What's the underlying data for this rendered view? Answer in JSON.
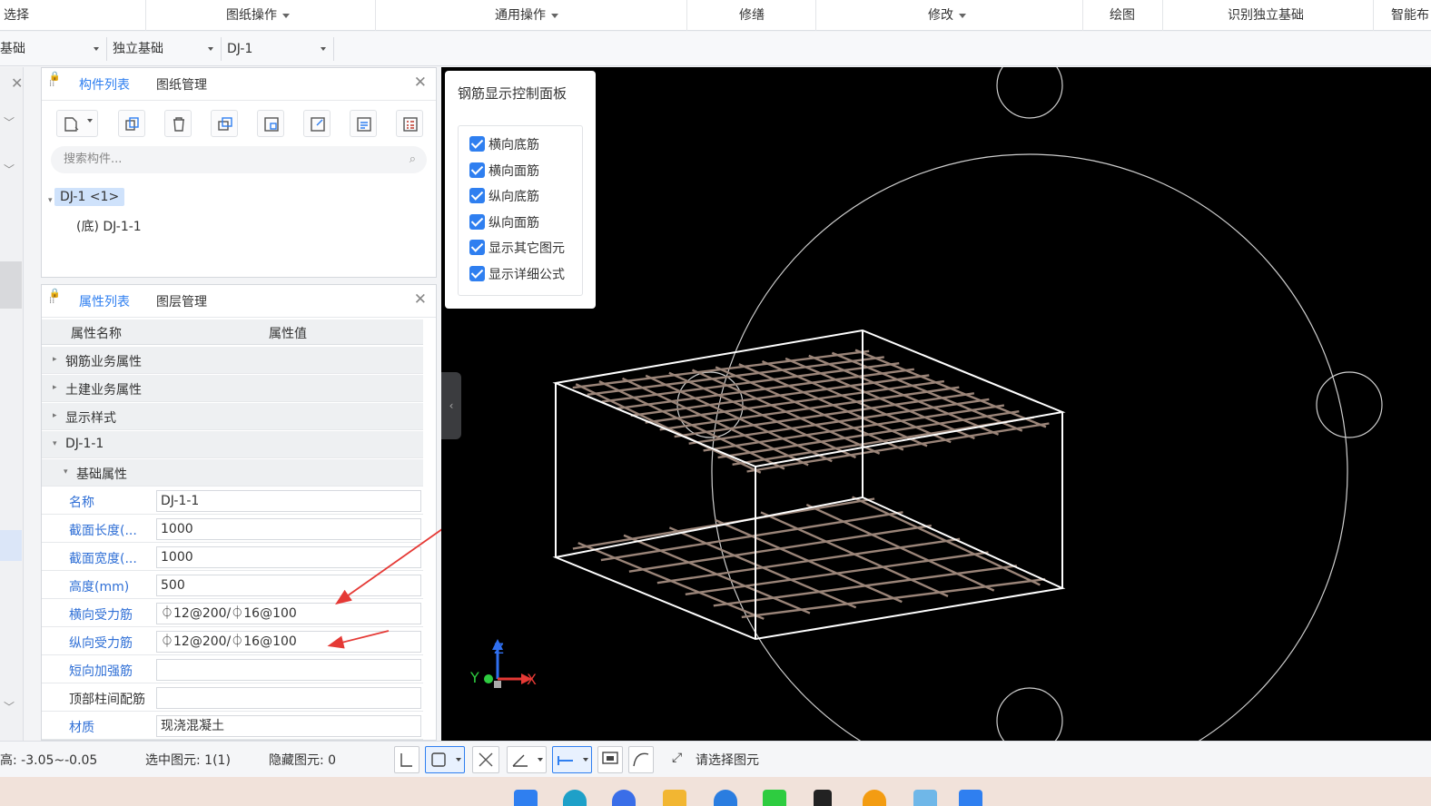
{
  "menubar": {
    "select": "选择",
    "drawing_ops": "图纸操作",
    "common_ops": "通用操作",
    "trim": "修缮",
    "modify": "修改",
    "draw": "绘图",
    "recognize": "识别独立基础",
    "smart": "智能布"
  },
  "selectors": {
    "category": "基础",
    "type": "独立基础",
    "item": "DJ-1"
  },
  "component_panel": {
    "tab_list": "构件列表",
    "tab_drawing": "图纸管理",
    "search_placeholder": "搜索构件...",
    "tree": {
      "root": "DJ-1 <1>",
      "child": "(底) DJ-1-1"
    }
  },
  "property_panel": {
    "tab_props": "属性列表",
    "tab_layers": "图层管理",
    "col_name": "属性名称",
    "col_value": "属性值",
    "groups": {
      "rebar": "钢筋业务属性",
      "civil": "土建业务属性",
      "display": "显示样式",
      "dj": "DJ-1-1",
      "base": "基础属性"
    },
    "rows": [
      {
        "name": "名称",
        "value": "DJ-1-1"
      },
      {
        "name": "截面长度(...",
        "value": "1000"
      },
      {
        "name": "截面宽度(...",
        "value": "1000"
      },
      {
        "name": "高度(mm)",
        "value": "500"
      },
      {
        "name": "横向受力筋",
        "value": "⏀12@200/⏀16@100"
      },
      {
        "name": "纵向受力筋",
        "value": "⏀12@200/⏀16@100"
      },
      {
        "name": "短向加强筋",
        "value": ""
      },
      {
        "name": "顶部柱间配筋",
        "value": ""
      },
      {
        "name": "材质",
        "value": "现浇混凝土"
      }
    ]
  },
  "rebar_panel": {
    "title": "钢筋显示控制面板",
    "options": [
      "横向底筋",
      "横向面筋",
      "纵向底筋",
      "纵向面筋",
      "显示其它图元",
      "显示详细公式"
    ]
  },
  "axes": {
    "x": "X",
    "y": "Y",
    "z": "Z"
  },
  "status": {
    "elevation": "高:  -3.05~-0.05",
    "selected": "选中图元: 1(1)",
    "hidden": "隐藏图元: 0",
    "prompt": "请选择图元"
  },
  "colors": {
    "accent": "#2f7ff0",
    "viewport_bg": "#000000",
    "rebar": "#9a8478",
    "arrow": "#e53935"
  }
}
